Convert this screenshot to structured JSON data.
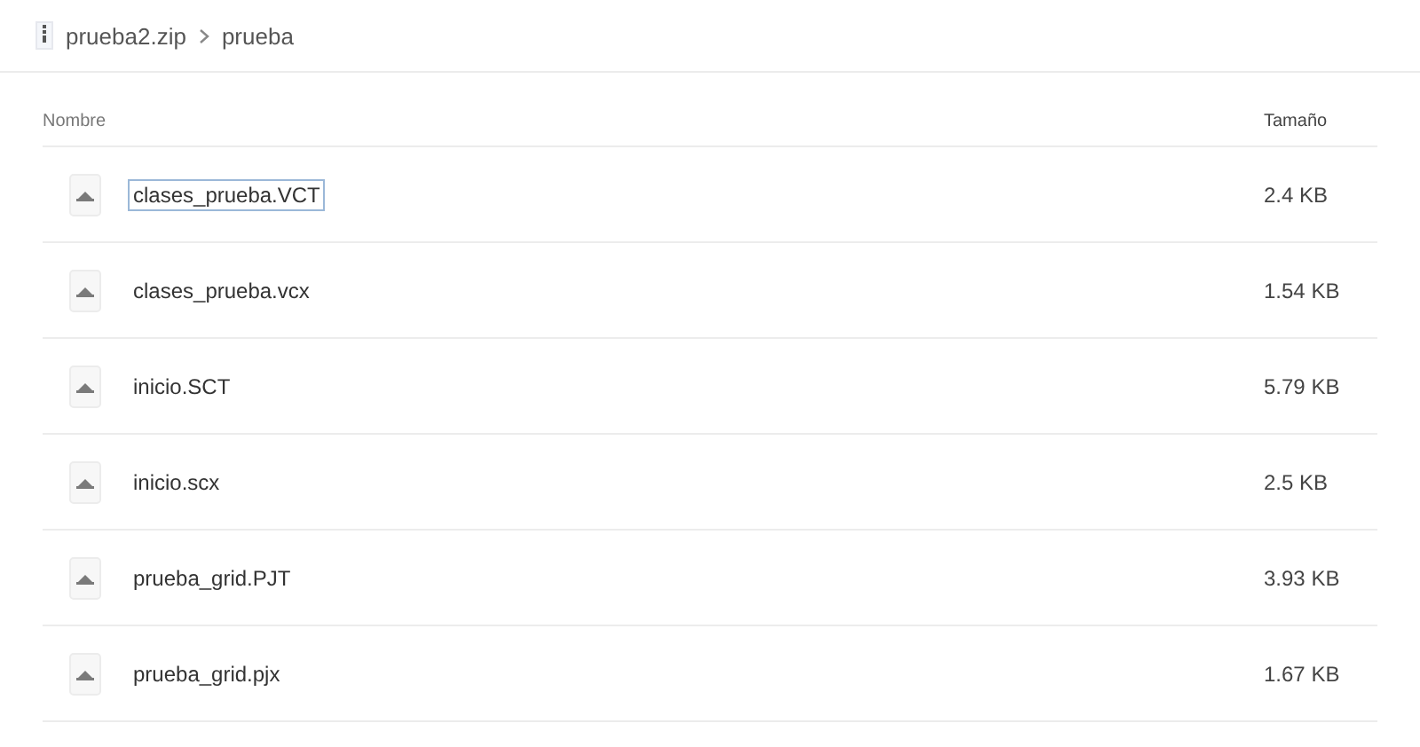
{
  "breadcrumb": [
    {
      "label": "prueba2.zip",
      "kind": "zip"
    },
    {
      "label": "prueba",
      "kind": "folder"
    }
  ],
  "table": {
    "columns": [
      "Nombre",
      "Tamaño"
    ],
    "rows": [
      {
        "name": "clases_prueba.VCT",
        "size": "2.4 KB",
        "selected": true
      },
      {
        "name": "clases_prueba.vcx",
        "size": "1.54 KB",
        "selected": false
      },
      {
        "name": "inicio.SCT",
        "size": "5.79 KB",
        "selected": false
      },
      {
        "name": "inicio.scx",
        "size": "2.5 KB",
        "selected": false
      },
      {
        "name": "prueba_grid.PJT",
        "size": "3.93 KB",
        "selected": false
      },
      {
        "name": "prueba_grid.pjx",
        "size": "1.67 KB",
        "selected": false
      }
    ]
  }
}
